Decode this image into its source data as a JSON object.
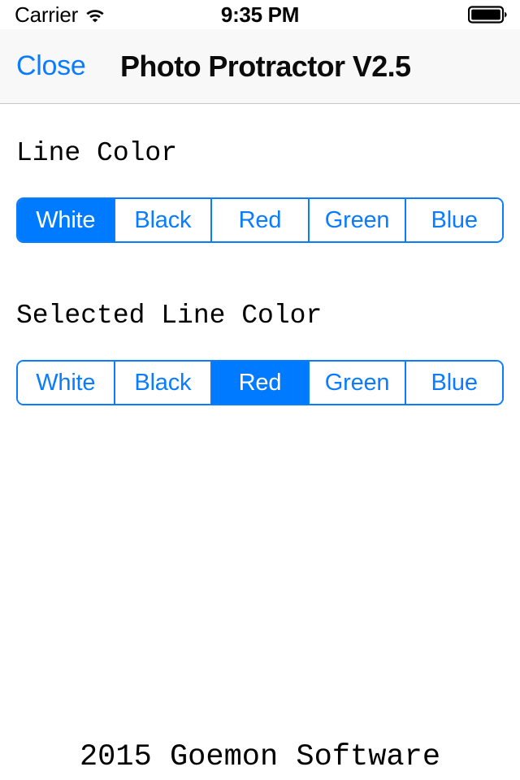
{
  "status_bar": {
    "carrier": "Carrier",
    "wifi_icon": "wifi-icon",
    "time": "9:35 PM",
    "battery_icon": "battery-full-icon"
  },
  "nav_bar": {
    "close_label": "Close",
    "title": "Photo Protractor V2.5"
  },
  "theme": {
    "accent": "#007aff",
    "tint_text": "#0a7cff",
    "nav_background": "#f8f8f8",
    "separator": "#c8c7cc",
    "background": "#ffffff"
  },
  "sections": [
    {
      "label": "Line Color",
      "options": [
        "White",
        "Black",
        "Red",
        "Green",
        "Blue"
      ],
      "selected": "White",
      "selected_index": 0
    },
    {
      "label": "Selected Line Color",
      "options": [
        "White",
        "Black",
        "Red",
        "Green",
        "Blue"
      ],
      "selected": "Red",
      "selected_index": 2
    }
  ],
  "footer": {
    "copyright": "2015 Goemon Software"
  }
}
